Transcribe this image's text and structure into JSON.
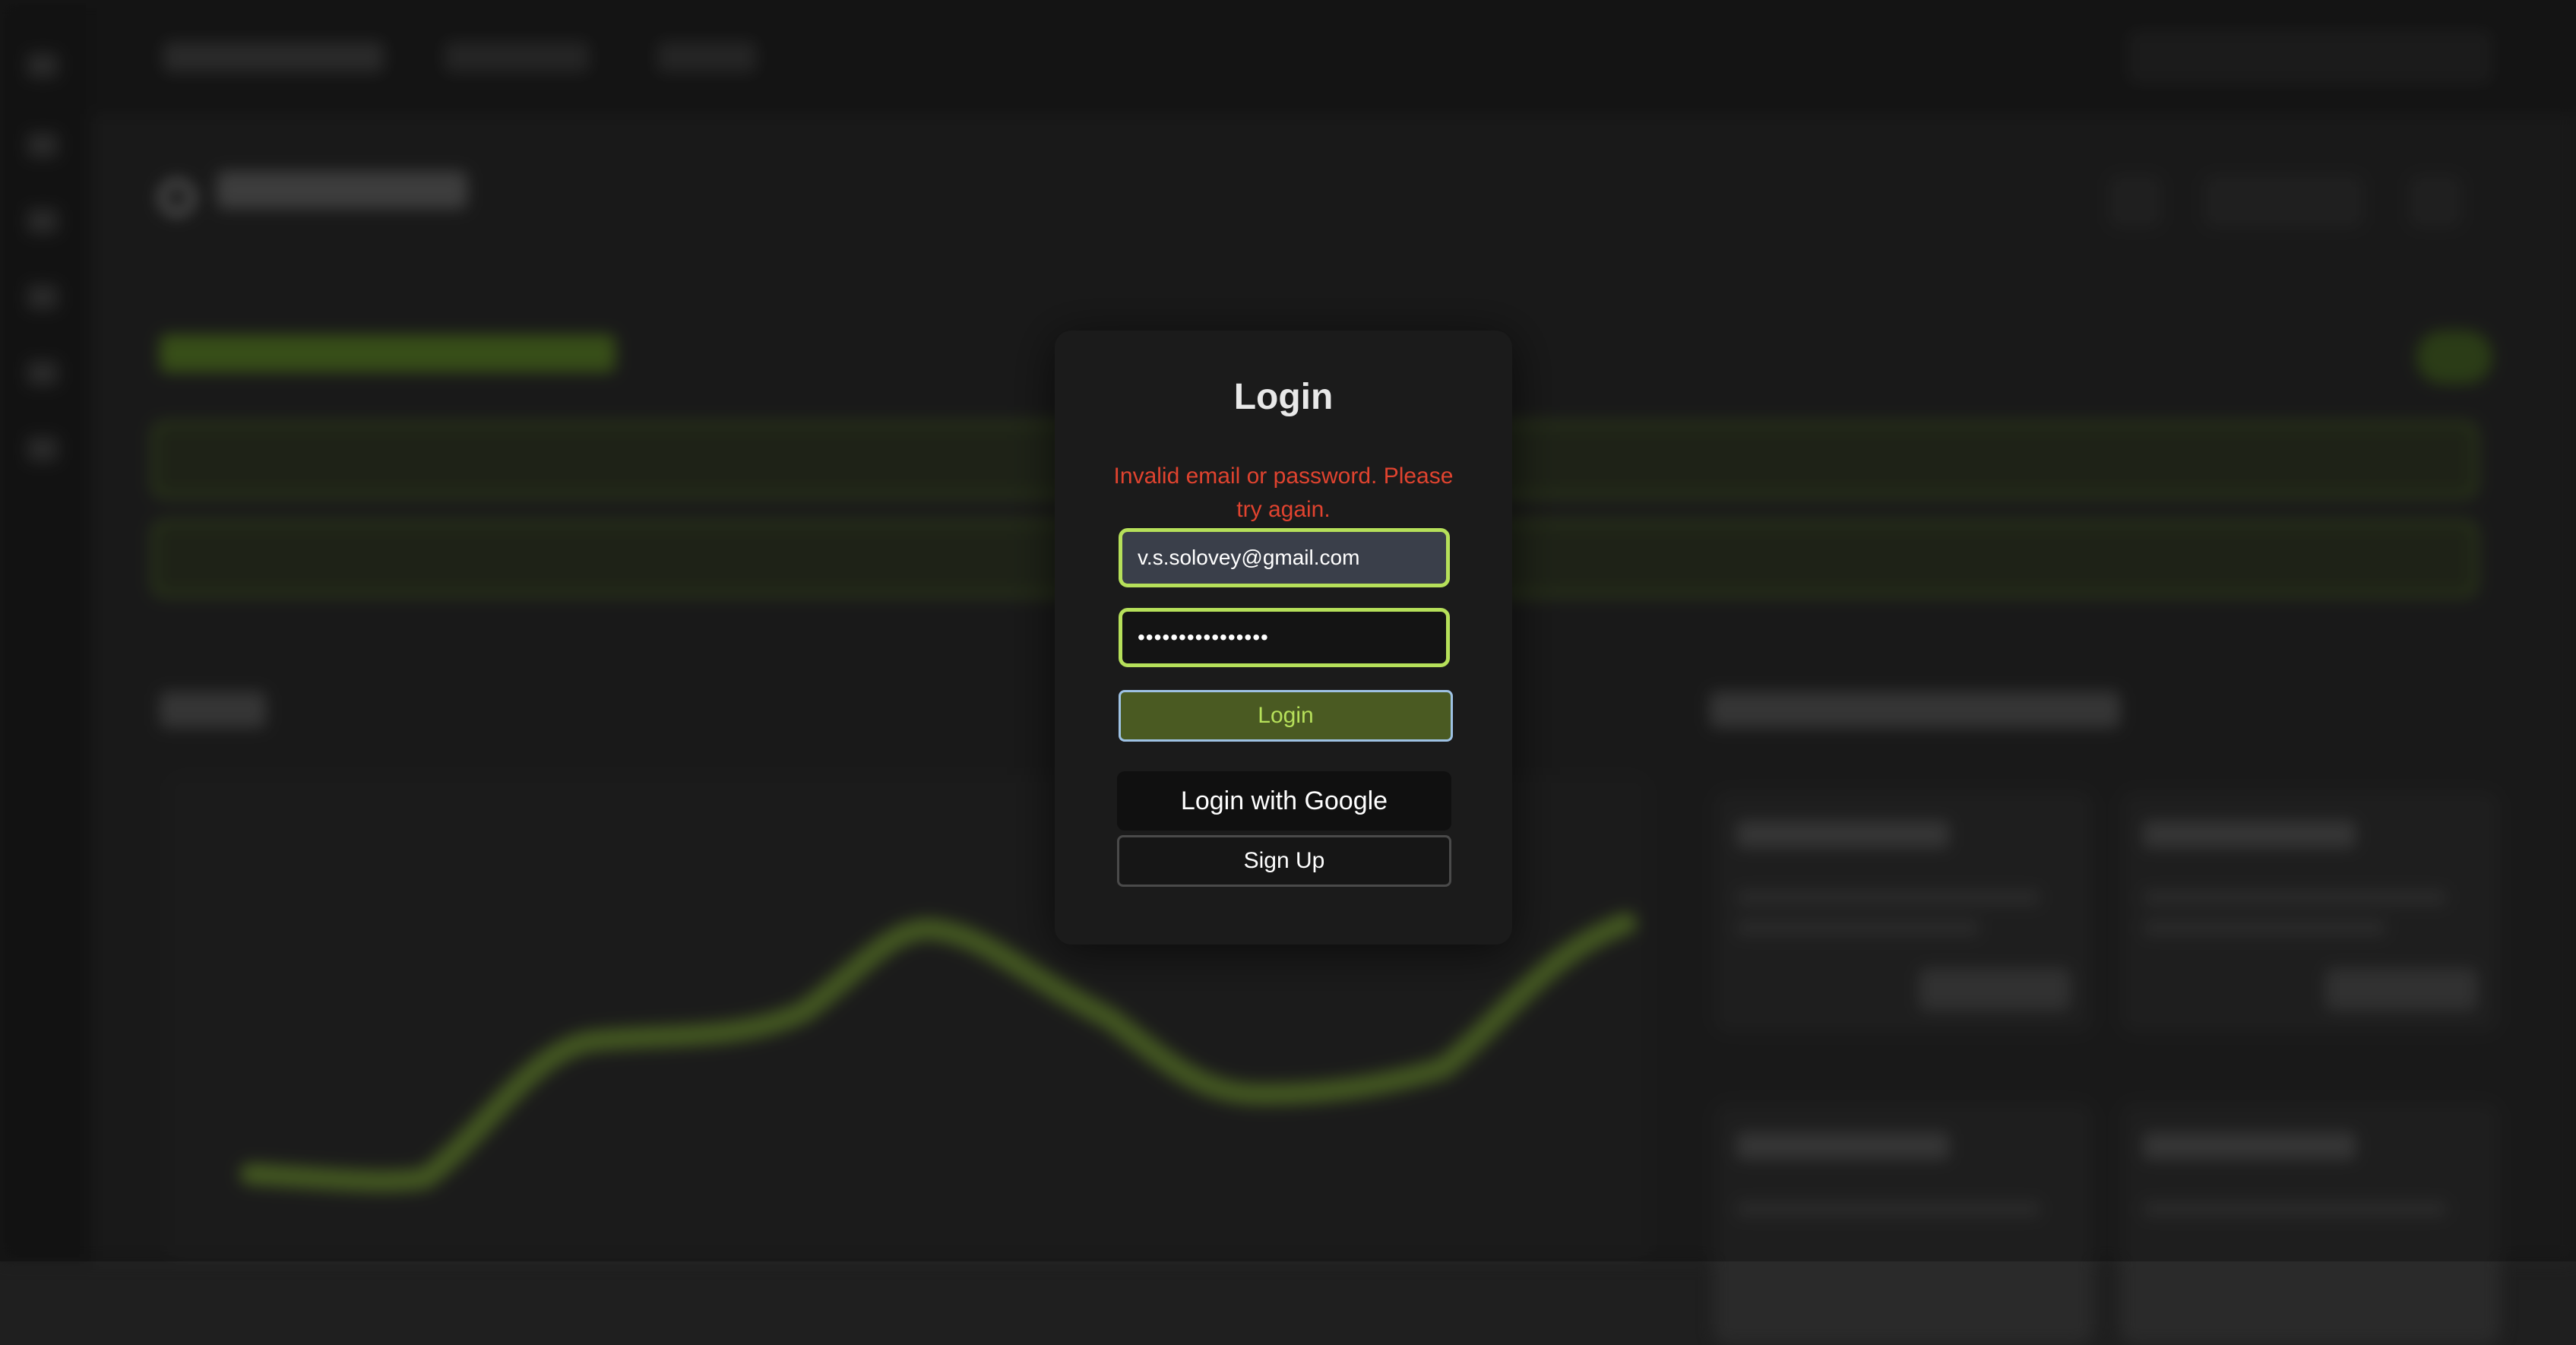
{
  "login": {
    "title": "Login",
    "error": "Invalid email or password. Please try again.",
    "email_value": "v.s.solovey@gmail.com",
    "password_value": "••••••••••••••••",
    "login_button": "Login",
    "google_button": "Login with Google",
    "signup_button": "Sign Up"
  },
  "colors": {
    "accent": "#b6e05a",
    "error": "#e0432f",
    "login_button_bg": "#4a5a22",
    "modal_bg": "#1b1b1b"
  }
}
